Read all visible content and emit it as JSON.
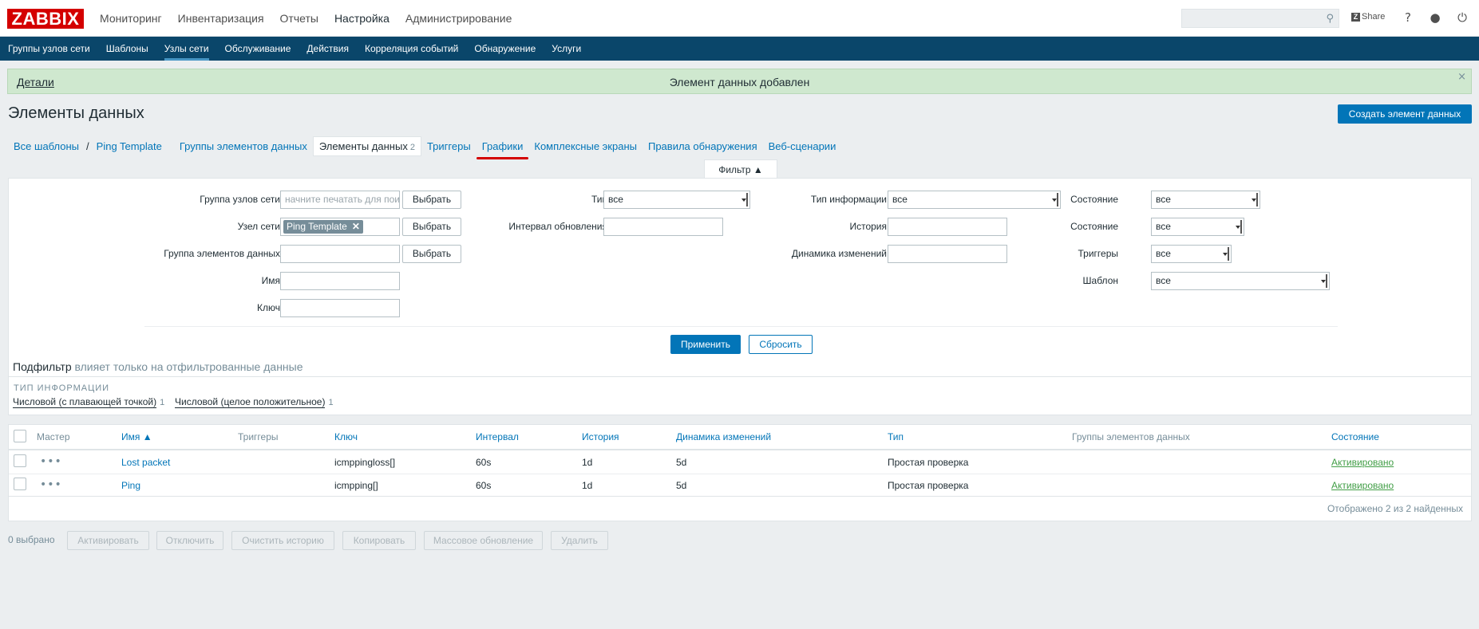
{
  "brand": {
    "logo": "ZABBIX"
  },
  "main_nav": [
    "Мониторинг",
    "Инвентаризация",
    "Отчеты",
    "Настройка",
    "Администрирование"
  ],
  "header": {
    "share": "Share"
  },
  "sub_nav": [
    "Группы узлов сети",
    "Шаблоны",
    "Узлы сети",
    "Обслуживание",
    "Действия",
    "Корреляция событий",
    "Обнаружение",
    "Услуги"
  ],
  "message": {
    "details": "Детали",
    "text": "Элемент данных добавлен",
    "close": "×"
  },
  "page": {
    "title": "Элементы данных",
    "create_button": "Создать элемент данных"
  },
  "breadcrumbs": {
    "all_templates": "Все шаблоны",
    "sep": "/",
    "template": "Ping Template",
    "tabs": [
      {
        "label": "Группы элементов данных"
      },
      {
        "label": "Элементы данных",
        "count": "2"
      },
      {
        "label": "Триггеры"
      },
      {
        "label": "Графики"
      },
      {
        "label": "Комплексные экраны"
      },
      {
        "label": "Правила обнаружения"
      },
      {
        "label": "Веб-сценарии"
      }
    ]
  },
  "filter": {
    "tab_label": "Фильтр ▲",
    "host_group_label": "Группа узлов сети",
    "host_group_placeholder": "начните печатать для поиска",
    "select_label": "Выбрать",
    "host_label": "Узел сети",
    "host_tag": "Ping Template",
    "app_label": "Группа элементов данных",
    "name_label": "Имя",
    "key_label": "Ключ",
    "type_label": "Тип",
    "type_value": "все",
    "interval_label": "Интервал обновления",
    "info_type_label": "Тип информации",
    "info_type_value": "все",
    "history_label": "История",
    "trends_label": "Динамика изменений",
    "state_label": "Состояние",
    "state_value": "все",
    "status_label": "Состояние",
    "status_value": "все",
    "triggers_label": "Триггеры",
    "triggers_value": "все",
    "template_label": "Шаблон",
    "template_value": "все",
    "apply": "Применить",
    "reset": "Сбросить"
  },
  "subfilter": {
    "title": "Подфильтр",
    "desc": "влияет только на отфильтрованные данные",
    "heading": "ТИП ИНФОРМАЦИИ",
    "items": [
      {
        "label": "Числовой (с плавающей точкой)",
        "count": "1"
      },
      {
        "label": "Числовой (целое положительное)",
        "count": "1"
      }
    ]
  },
  "table": {
    "headers": {
      "master": "Мастер",
      "name": "Имя ▲",
      "triggers": "Триггеры",
      "key": "Ключ",
      "interval": "Интервал",
      "history": "История",
      "trends": "Динамика изменений",
      "type": "Тип",
      "apps": "Группы элементов данных",
      "status": "Состояние"
    },
    "rows": [
      {
        "dots": "•••",
        "name": "Lost packet",
        "key": "icmppingloss[]",
        "interval": "60s",
        "history": "1d",
        "trends": "5d",
        "type": "Простая проверка",
        "status": "Активировано"
      },
      {
        "dots": "•••",
        "name": "Ping",
        "key": "icmpping[]",
        "interval": "60s",
        "history": "1d",
        "trends": "5d",
        "type": "Простая проверка",
        "status": "Активировано"
      }
    ],
    "footer": "Отображено 2 из 2 найденных"
  },
  "actions": {
    "selected": "0 выбрано",
    "buttons": [
      "Активировать",
      "Отключить",
      "Очистить историю",
      "Копировать",
      "Массовое обновление",
      "Удалить"
    ]
  }
}
